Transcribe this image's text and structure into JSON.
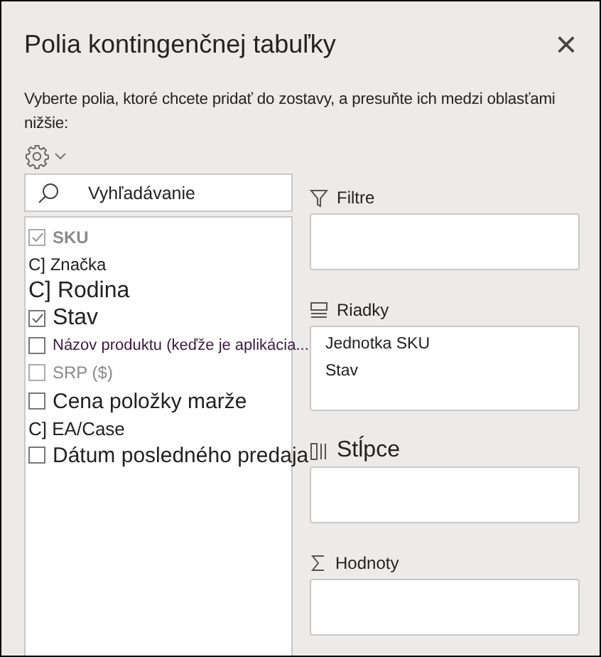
{
  "panel": {
    "title": "Polia kontingenčnej tabuľky",
    "close": "×",
    "description": "Vyberte polia, ktoré chcete pridať do zostavy, a presuňte ich medzi oblasťami nižšie:"
  },
  "search": {
    "placeholder": "Vyhľadávanie"
  },
  "fields": [
    {
      "kind": "checkbox",
      "label": "SKU",
      "checked": true,
      "disabled": true
    },
    {
      "kind": "text",
      "label": "C] Značka"
    },
    {
      "kind": "text",
      "label": "C] Rodina"
    },
    {
      "kind": "checkbox",
      "label": "Stav",
      "checked": true,
      "disabled": false
    },
    {
      "kind": "checkbox",
      "label": "Názov produktu (keďže je aplikácia...",
      "checked": false,
      "disabled": false
    },
    {
      "kind": "checkbox",
      "label": "SRP ($)",
      "checked": false,
      "disabled": true
    },
    {
      "kind": "checkbox",
      "label": "Cena položky marže",
      "checked": false,
      "disabled": false
    },
    {
      "kind": "text",
      "label": "C] EA/Case"
    },
    {
      "kind": "checkbox",
      "label": "Dátum posledného predaja",
      "checked": false,
      "disabled": false
    }
  ],
  "areas": [
    {
      "kind": "filter",
      "label": "Filtre"
    },
    {
      "kind": "rows",
      "label": "Riadky",
      "items": [
        "Jednotka SKU",
        "Stav"
      ]
    },
    {
      "kind": "columns",
      "label": "Stĺpce"
    },
    {
      "kind": "values",
      "label": "Hodnoty"
    }
  ]
}
